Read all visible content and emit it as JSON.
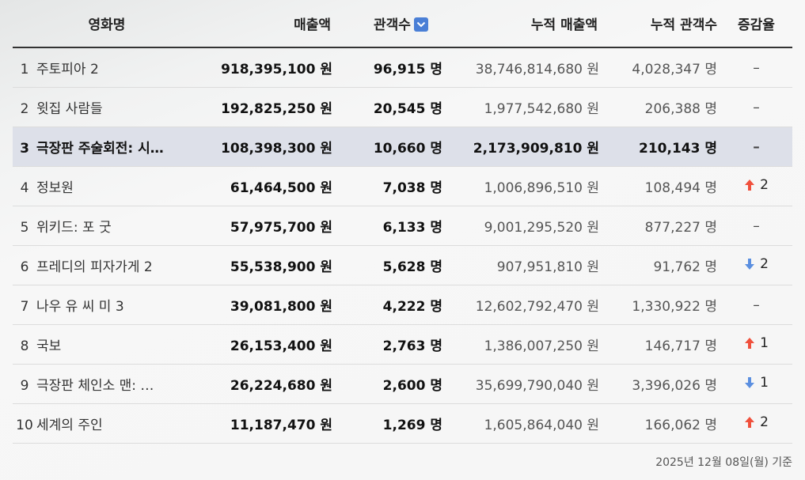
{
  "headers": {
    "movie": "영화명",
    "sales": "매출액",
    "audience": "관객수",
    "cum_sales": "누적 매출액",
    "cum_audience": "누적 관객수",
    "change": "증감율"
  },
  "sort_icon": "chevron-down-icon",
  "colors": {
    "up": "#f0503c",
    "down": "#5b8fe0",
    "highlight": "#dde0e9",
    "sort": "#4a7fd6"
  },
  "rows": [
    {
      "rank": "1",
      "title": "주토피아 2",
      "sales": "918,395,100 원",
      "audience": "96,915 명",
      "cum_sales": "38,746,814,680 원",
      "cum_audience": "4,028,347 명",
      "change_dir": "none",
      "change_text": "–"
    },
    {
      "rank": "2",
      "title": "윗집 사람들",
      "sales": "192,825,250 원",
      "audience": "20,545 명",
      "cum_sales": "1,977,542,680 원",
      "cum_audience": "206,388 명",
      "change_dir": "none",
      "change_text": "–"
    },
    {
      "rank": "3",
      "title": "극장판 주술회전: 시…",
      "sales": "108,398,300 원",
      "audience": "10,660 명",
      "cum_sales": "2,173,909,810 원",
      "cum_audience": "210,143 명",
      "change_dir": "none",
      "change_text": "–",
      "highlight": true
    },
    {
      "rank": "4",
      "title": "정보원",
      "sales": "61,464,500 원",
      "audience": "7,038 명",
      "cum_sales": "1,006,896,510 원",
      "cum_audience": "108,494 명",
      "change_dir": "up",
      "change_text": "2"
    },
    {
      "rank": "5",
      "title": "위키드: 포 굿",
      "sales": "57,975,700 원",
      "audience": "6,133 명",
      "cum_sales": "9,001,295,520 원",
      "cum_audience": "877,227 명",
      "change_dir": "none",
      "change_text": "–"
    },
    {
      "rank": "6",
      "title": "프레디의 피자가게 2",
      "sales": "55,538,900 원",
      "audience": "5,628 명",
      "cum_sales": "907,951,810 원",
      "cum_audience": "91,762 명",
      "change_dir": "down",
      "change_text": "2"
    },
    {
      "rank": "7",
      "title": "나우 유 씨 미 3",
      "sales": "39,081,800 원",
      "audience": "4,222 명",
      "cum_sales": "12,602,792,470 원",
      "cum_audience": "1,330,922 명",
      "change_dir": "none",
      "change_text": "–"
    },
    {
      "rank": "8",
      "title": "국보",
      "sales": "26,153,400 원",
      "audience": "2,763 명",
      "cum_sales": "1,386,007,250 원",
      "cum_audience": "146,717 명",
      "change_dir": "up",
      "change_text": "1"
    },
    {
      "rank": "9",
      "title": "극장판 체인소 맨: …",
      "sales": "26,224,680 원",
      "audience": "2,600 명",
      "cum_sales": "35,699,790,040 원",
      "cum_audience": "3,396,026 명",
      "change_dir": "down",
      "change_text": "1"
    },
    {
      "rank": "10",
      "title": "세계의 주인",
      "sales": "11,187,470 원",
      "audience": "1,269 명",
      "cum_sales": "1,605,864,040 원",
      "cum_audience": "166,062 명",
      "change_dir": "up",
      "change_text": "2"
    }
  ],
  "footer": "2025년 12월 08일(월) 기준"
}
